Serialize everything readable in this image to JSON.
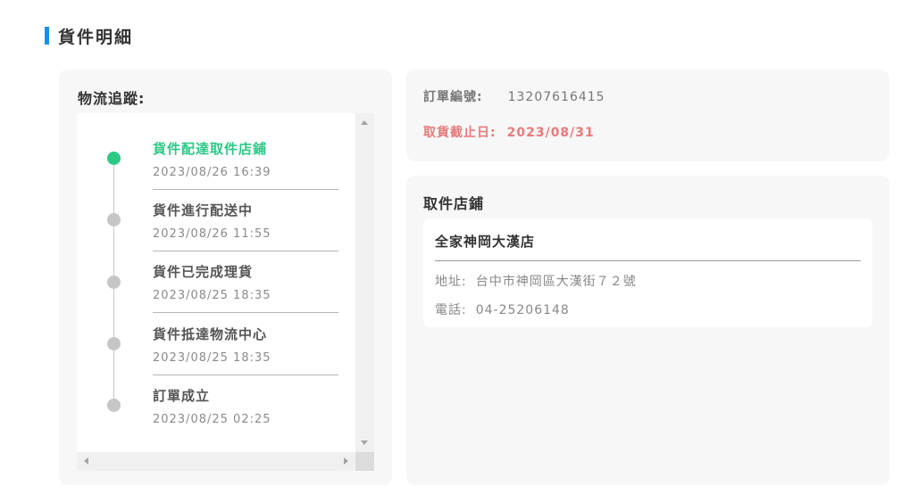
{
  "header": {
    "title": "貨件明細"
  },
  "tracking": {
    "title": "物流追蹤:",
    "items": [
      {
        "label": "貨件配達取件店鋪",
        "time": "2023/08/26  16:39",
        "active": true
      },
      {
        "label": "貨件進行配送中",
        "time": "2023/08/26  11:55",
        "active": false
      },
      {
        "label": "貨件已完成理貨",
        "time": "2023/08/25  18:35",
        "active": false
      },
      {
        "label": "貨件抵達物流中心",
        "time": "2023/08/25  18:35",
        "active": false
      },
      {
        "label": "訂單成立",
        "time": "2023/08/25  02:25",
        "active": false
      }
    ]
  },
  "order": {
    "number_label": "訂單編號:",
    "number_value": "13207616415",
    "deadline_label": "取貨截止日:",
    "deadline_value": "2023/08/31"
  },
  "store": {
    "title": "取件店鋪",
    "name": "全家神岡大漢店",
    "address_label": "地址:",
    "address_value": "台中市神岡區大漢街７２號",
    "phone_label": "電話:",
    "phone_value": "04-25206148"
  },
  "colors": {
    "accent_blue": "#1a8ee6",
    "active_green": "#2cc985",
    "deadline_red": "#e9797a",
    "inactive_dot": "#c6c6c6"
  }
}
